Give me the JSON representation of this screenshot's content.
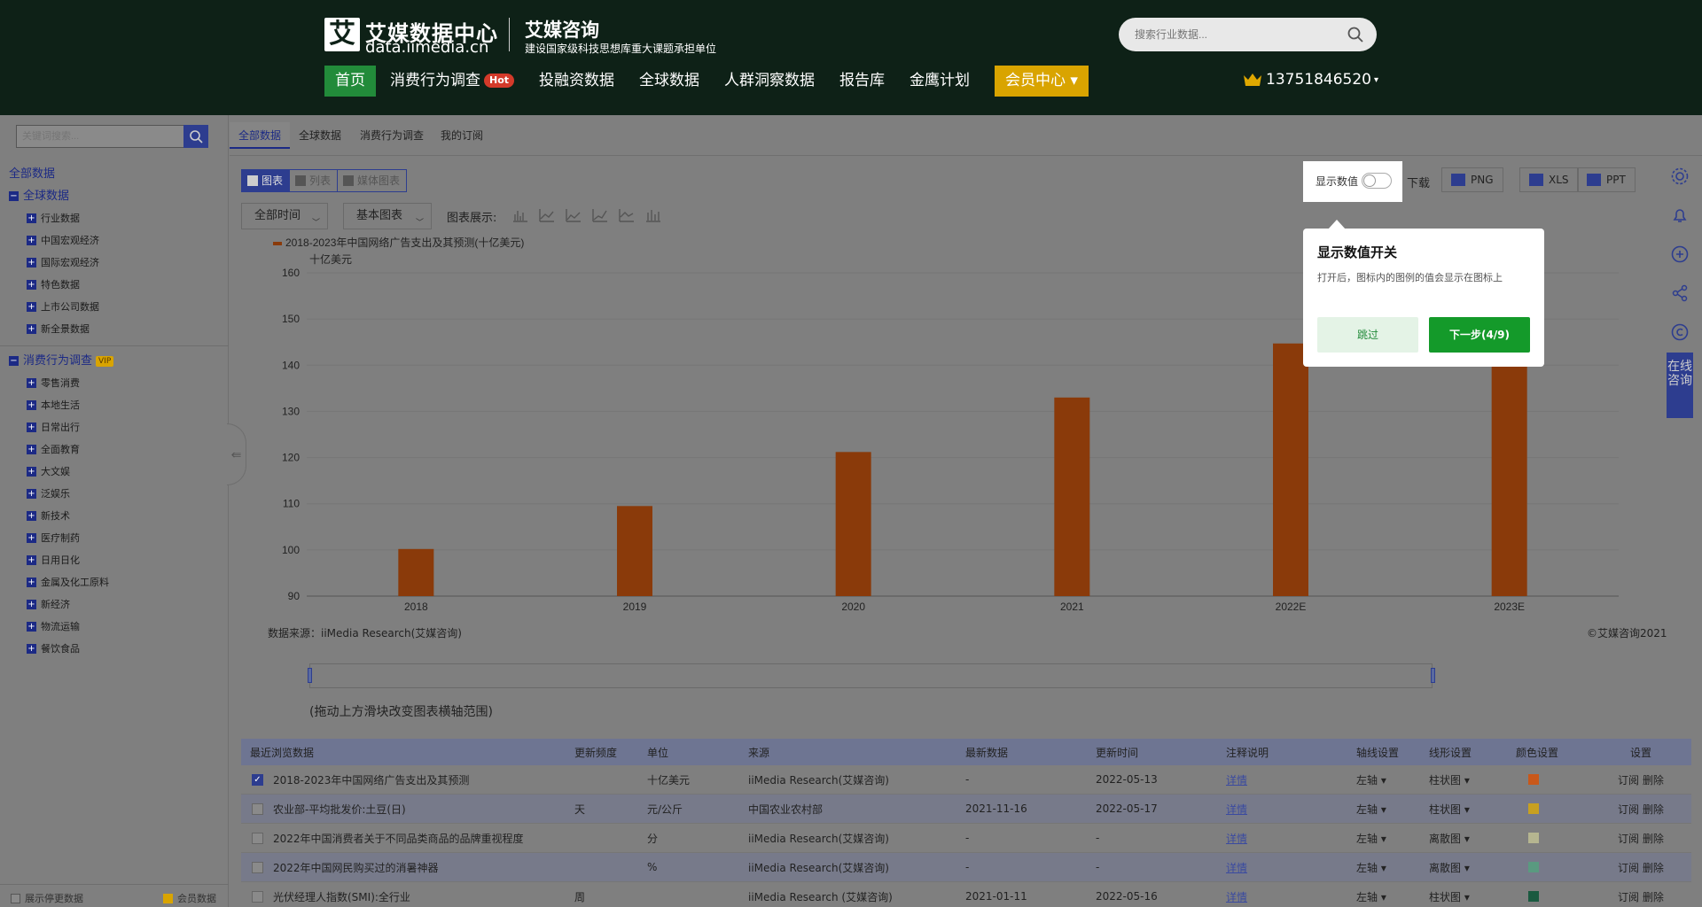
{
  "header": {
    "logo_char": "艾",
    "logo_title": "艾媒数据中心",
    "logo_url": "data.iimedia.cn",
    "brand_title": "艾媒咨询",
    "brand_sub": "建设国家级科技思想库重大课题承担单位",
    "search_placeholder": "搜索行业数据...",
    "nav": [
      {
        "label": "首页"
      },
      {
        "label": "消费行为调查",
        "badge": "Hot"
      },
      {
        "label": "投融资数据"
      },
      {
        "label": "全球数据"
      },
      {
        "label": "人群洞察数据"
      },
      {
        "label": "报告库"
      },
      {
        "label": "金鹰计划"
      },
      {
        "label": "会员中心 ▾"
      }
    ],
    "user": "13751846520"
  },
  "sidebar": {
    "search_placeholder": "关键词搜索...",
    "all_label": "全部数据",
    "group1": {
      "label": "全球数据",
      "items": [
        "行业数据",
        "中国宏观经济",
        "国际宏观经济",
        "特色数据",
        "上市公司数据",
        "新全景数据"
      ]
    },
    "group2": {
      "label": "消费行为调查",
      "badge": "VIP",
      "items": [
        "零售消费",
        "本地生活",
        "日常出行",
        "全面教育",
        "大文娱",
        "泛娱乐",
        "新技术",
        "医疗制药",
        "日用日化",
        "金属及化工原料",
        "新经济",
        "物流运输",
        "餐饮食品"
      ]
    },
    "footer": {
      "left": "展示停更数据",
      "right": "会员数据"
    }
  },
  "top_tabs": [
    "全部数据",
    "全球数据",
    "消费行为调查",
    "我的订阅"
  ],
  "toolbar": {
    "views": [
      "图表",
      "列表",
      "媒体图表"
    ],
    "time_select": "全部时间",
    "chart_select": "基本图表",
    "chart_show_label": "图表展示:",
    "download_label": "下载",
    "downloads": [
      "PNG",
      "XLS",
      "PPT"
    ],
    "toggle_label": "显示数值"
  },
  "chart_data": {
    "type": "bar",
    "legend": "2018-2023年中国网络广告支出及其预测(十亿美元)",
    "ylabel": "十亿美元",
    "categories": [
      "2018",
      "2019",
      "2020",
      "2021",
      "2022E",
      "2023E"
    ],
    "values": [
      100.2,
      109.5,
      121.2,
      133.0,
      144.7,
      141.5
    ],
    "ylim": [
      90,
      160
    ],
    "yticks": [
      90,
      100,
      110,
      120,
      130,
      140,
      150,
      160
    ],
    "color": "#8a3a0a",
    "grid": true,
    "source": "数据来源：iiMedia Research(艾媒咨询)",
    "copyright": "©艾媒咨询2021"
  },
  "range_hint": "(拖动上方滑块改变图表横轴范围)",
  "table": {
    "headers": [
      "最近浏览数据",
      "更新频度",
      "单位",
      "来源",
      "最新数据",
      "更新时间",
      "注释说明",
      "轴线设置",
      "线形设置",
      "颜色设置",
      "设置"
    ],
    "rows": [
      {
        "name": "2018-2023年中国网络广告支出及其预测",
        "freq": "",
        "unit": "十亿美元",
        "source": "iiMedia Research(艾媒咨询)",
        "latest": "-",
        "updated": "2022-05-13",
        "note": "详情",
        "axis": "左轴 ▾",
        "shape": "柱状图 ▾",
        "color": "#c8581a",
        "actions": "订阅 删除",
        "checked": true
      },
      {
        "name": "农业部-平均批发价:土豆(日)",
        "freq": "天",
        "unit": "元/公斤",
        "source": "中国农业农村部",
        "latest": "2021-11-16",
        "updated": "2022-05-17",
        "note": "详情",
        "axis": "左轴 ▾",
        "shape": "柱状图 ▾",
        "color": "#c8a020",
        "actions": "订阅 删除",
        "checked": false
      },
      {
        "name": "2022年中国消费者关于不同品类商品的品牌重视程度",
        "freq": "",
        "unit": "分",
        "source": "iiMedia Research(艾媒咨询)",
        "latest": "-",
        "updated": "-",
        "note": "详情",
        "axis": "左轴 ▾",
        "shape": "离散图 ▾",
        "color": "#b5b590",
        "actions": "订阅 删除",
        "checked": false
      },
      {
        "name": "2022年中国网民购买过的消暑神器",
        "freq": "",
        "unit": "%",
        "source": "iiMedia Research(艾媒咨询)",
        "latest": "-",
        "updated": "-",
        "note": "详情",
        "axis": "左轴 ▾",
        "shape": "离散图 ▾",
        "color": "#5a9a80",
        "actions": "订阅 删除",
        "checked": false
      },
      {
        "name": "光伏经理人指数(SMI):全行业",
        "freq": "周",
        "unit": "",
        "source": "iiMedia Research (艾媒咨询)",
        "latest": "2021-01-11",
        "updated": "2022-05-16",
        "note": "详情",
        "axis": "左轴 ▾",
        "shape": "柱状图 ▾",
        "color": "#1a5a40",
        "actions": "订阅 删除",
        "checked": false
      }
    ]
  },
  "right_tools": {
    "consult_label": "在线咨询"
  },
  "guide": {
    "title": "显示数值开关",
    "desc": "打开后，图标内的图例的值会显示在图标上",
    "skip": "跳过",
    "next": "下一步(4/9)"
  }
}
